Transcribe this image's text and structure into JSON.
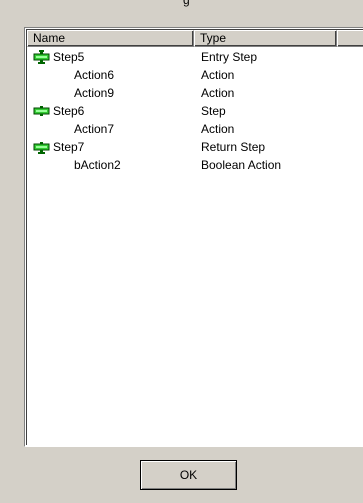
{
  "window": {
    "title_fragment": "g"
  },
  "list": {
    "columns": [
      "Name",
      "Type",
      ""
    ],
    "rows": [
      {
        "name": "Step5",
        "type": "Entry Step",
        "kind": "entry-step",
        "indent": false
      },
      {
        "name": "Action6",
        "type": "Action",
        "kind": "action",
        "indent": true
      },
      {
        "name": "Action9",
        "type": "Action",
        "kind": "action",
        "indent": true
      },
      {
        "name": "Step6",
        "type": "Step",
        "kind": "step",
        "indent": false
      },
      {
        "name": "Action7",
        "type": "Action",
        "kind": "action",
        "indent": true
      },
      {
        "name": "Step7",
        "type": "Return Step",
        "kind": "return-step",
        "indent": false
      },
      {
        "name": "bAction2",
        "type": "Boolean Action",
        "kind": "action",
        "indent": true
      }
    ]
  },
  "buttons": {
    "ok_label": "OK"
  },
  "colors": {
    "dialog_bg": "#d4d0c8",
    "list_bg": "#ffffff",
    "step_icon_green": "#33cc33",
    "step_icon_dark": "#006600"
  }
}
